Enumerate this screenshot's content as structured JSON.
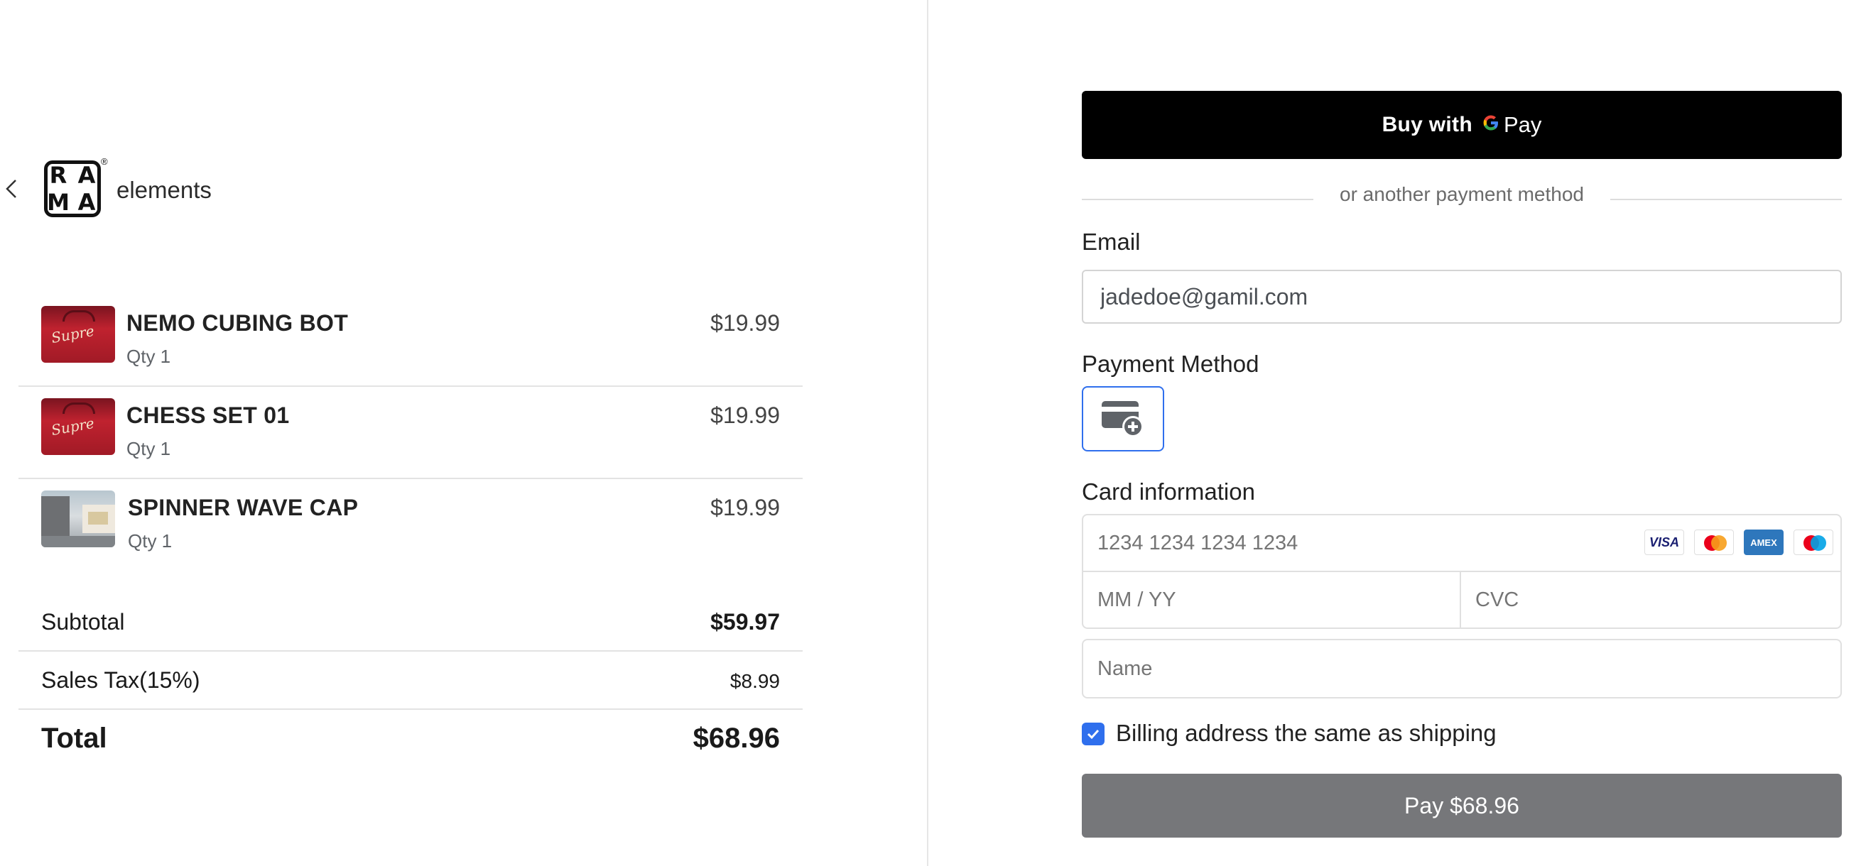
{
  "header": {
    "back_icon": "chevron-left-icon",
    "logo_letters": [
      "R",
      "A",
      "M",
      "A"
    ],
    "logo_registered": "®",
    "brand_name": "elements"
  },
  "order": {
    "items": [
      {
        "name": "NEMO CUBING BOT",
        "qty": "Qty 1",
        "price": "$19.99",
        "thumbnail": "red-bag"
      },
      {
        "name": "CHESS SET 01",
        "qty": "Qty 1",
        "price": "$19.99",
        "thumbnail": "red-bag"
      },
      {
        "name": "SPINNER WAVE CAP",
        "qty": "Qty 1",
        "price": "$19.99",
        "thumbnail": "street-photo"
      }
    ],
    "subtotal_label": "Subtotal",
    "subtotal_value": "$59.97",
    "tax_label": "Sales Tax(15%)",
    "tax_value": "$8.99",
    "total_label": "Total",
    "total_value": "$68.96"
  },
  "payment": {
    "gpay": {
      "buy_with": "Buy with",
      "g": "G",
      "pay": "Pay"
    },
    "divider_text": "or another payment method",
    "email_label": "Email",
    "email_value": "jadedoe@gamil.com",
    "method_label": "Payment Method",
    "method_icon": "card-add-icon",
    "card_label": "Card information",
    "card_number_placeholder": "1234 1234 1234 1234",
    "expiry_placeholder": "MM / YY",
    "cvc_placeholder": "CVC",
    "card_brands": {
      "visa": "VISA",
      "amex": "AMEX"
    },
    "name_placeholder": "Name",
    "billing_same_label": "Billing address the same as shipping",
    "billing_same_checked": true,
    "pay_button_label": "Pay $68.96"
  },
  "colors": {
    "accent": "#2f6fed",
    "pay_button": "#76777a",
    "gpay_button": "#000000"
  }
}
